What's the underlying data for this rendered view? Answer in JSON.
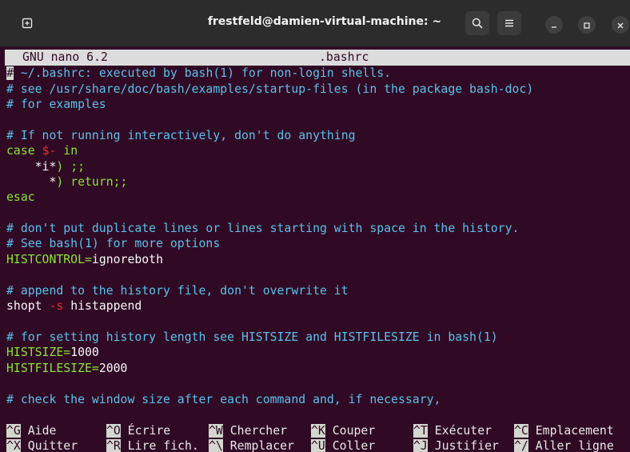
{
  "window": {
    "title": "frestfeld@damien-virtual-machine: ~",
    "new_tab_icon": "new-tab-icon",
    "search_icon": "search-icon",
    "menu_icon": "hamburger-menu-icon"
  },
  "nano": {
    "app_version": "GNU nano 6.2",
    "filename": ".bashrc"
  },
  "lines": [
    [
      "#",
      " ~/.bashrc: executed by bash(1) for non-login shells."
    ],
    [
      "# see /usr/share/doc/bash/examples/startup-files (in the package bash-doc)"
    ],
    [
      "# for examples"
    ],
    [
      ""
    ],
    [
      "# If not running interactively, don't do anything"
    ],
    [
      "case",
      " ",
      "$-",
      " in"
    ],
    [
      "    ",
      "*i*",
      ") ;;"
    ],
    [
      "      ",
      "*",
      ") return;;"
    ],
    [
      "esac"
    ],
    [
      ""
    ],
    [
      "# don't put duplicate lines or lines starting with space in the history."
    ],
    [
      "# See bash(1) for more options"
    ],
    [
      "HISTCONTROL=",
      "ignoreboth"
    ],
    [
      ""
    ],
    [
      "# append to the history file, don't overwrite it"
    ],
    [
      "shopt",
      " -s ",
      "histappend"
    ],
    [
      ""
    ],
    [
      "# for setting history length see HISTSIZE and HISTFILESIZE in bash(1)"
    ],
    [
      "HISTSIZE=",
      "1000"
    ],
    [
      "HISTFILESIZE=",
      "2000"
    ],
    [
      ""
    ],
    [
      "# check the window size after each command and, if necessary,"
    ]
  ],
  "shortcuts": [
    {
      "key": "^G",
      "label": "Aide"
    },
    {
      "key": "^O",
      "label": "Écrire"
    },
    {
      "key": "^W",
      "label": "Chercher"
    },
    {
      "key": "^K",
      "label": "Couper"
    },
    {
      "key": "^T",
      "label": "Exécuter"
    },
    {
      "key": "^C",
      "label": "Emplacement"
    },
    {
      "key": "^X",
      "label": "Quitter"
    },
    {
      "key": "^R",
      "label": "Lire fich."
    },
    {
      "key": "^\\",
      "label": "Remplacer"
    },
    {
      "key": "^U",
      "label": "Coller"
    },
    {
      "key": "^J",
      "label": "Justifier"
    },
    {
      "key": "^/",
      "label": "Aller ligne"
    }
  ]
}
